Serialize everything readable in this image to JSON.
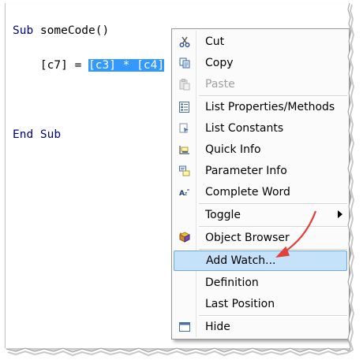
{
  "code": {
    "line1_kw": "Sub",
    "line1_rest": " someCode()",
    "line2_indent": "    [c7] = ",
    "line2_sel": "[c3] * [c4]",
    "line3_kw": "End Sub"
  },
  "menu": {
    "items": [
      {
        "label": "Cut",
        "icon": "scissors-icon",
        "enabled": true
      },
      {
        "label": "Copy",
        "icon": "copy-icon",
        "enabled": true
      },
      {
        "label": "Paste",
        "icon": "paste-icon",
        "enabled": false
      },
      {
        "label": "List Properties/Methods",
        "icon": "list-properties-icon",
        "enabled": true
      },
      {
        "label": "List Constants",
        "icon": "list-constants-icon",
        "enabled": true
      },
      {
        "label": "Quick Info",
        "icon": "quick-info-icon",
        "enabled": true
      },
      {
        "label": "Parameter Info",
        "icon": "parameter-info-icon",
        "enabled": true
      },
      {
        "label": "Complete Word",
        "icon": "complete-word-icon",
        "enabled": true
      },
      {
        "label": "Toggle",
        "icon": "",
        "enabled": true,
        "submenu": true
      },
      {
        "label": "Object Browser",
        "icon": "object-browser-icon",
        "enabled": true
      },
      {
        "label": "Add Watch...",
        "icon": "",
        "enabled": true,
        "highlighted": true
      },
      {
        "label": "Definition",
        "icon": "",
        "enabled": true
      },
      {
        "label": "Last Position",
        "icon": "",
        "enabled": true
      },
      {
        "label": "Hide",
        "icon": "hide-window-icon",
        "enabled": true
      }
    ]
  },
  "colors": {
    "selection": "#3399ff",
    "keyword": "#00008b",
    "highlight": "#c6e2f9",
    "annotation_arrow": "#e0413a"
  }
}
